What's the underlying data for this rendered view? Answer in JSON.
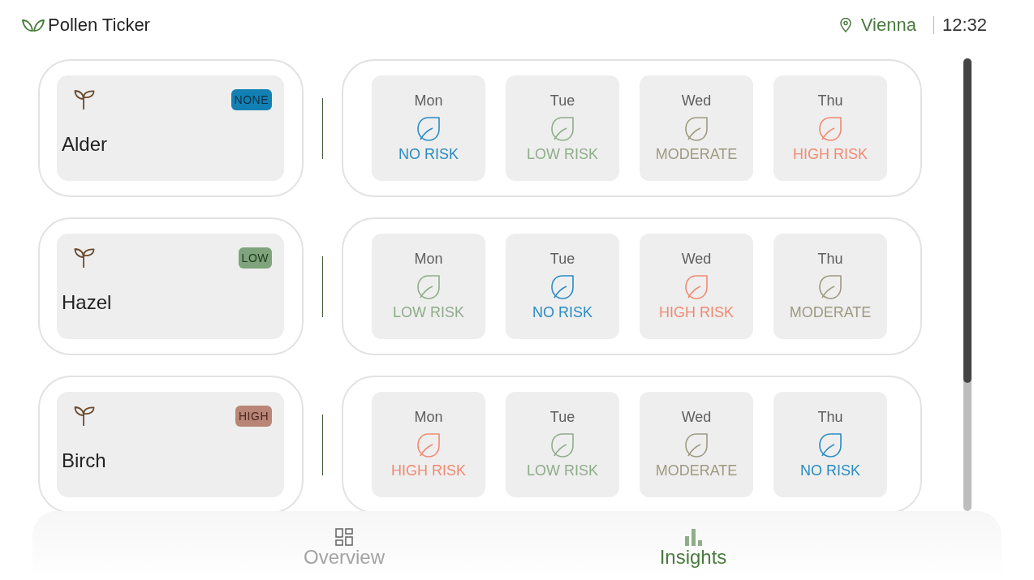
{
  "header": {
    "title": "Pollen Ticker",
    "location": "Vienna",
    "time": "12:32"
  },
  "pollen_types": [
    {
      "name": "Alder",
      "badge": "NONE",
      "kind": "none",
      "forecast": [
        {
          "day": "Mon",
          "risk": "NO RISK",
          "kind": "none"
        },
        {
          "day": "Tue",
          "risk": "LOW RISK",
          "kind": "low"
        },
        {
          "day": "Wed",
          "risk": "MODERATE",
          "kind": "moderate"
        },
        {
          "day": "Thu",
          "risk": "HIGH RISK",
          "kind": "high"
        }
      ]
    },
    {
      "name": "Hazel",
      "badge": "LOW",
      "kind": "low",
      "forecast": [
        {
          "day": "Mon",
          "risk": "LOW RISK",
          "kind": "low"
        },
        {
          "day": "Tue",
          "risk": "NO RISK",
          "kind": "none"
        },
        {
          "day": "Wed",
          "risk": "HIGH RISK",
          "kind": "high"
        },
        {
          "day": "Thu",
          "risk": "MODERATE",
          "kind": "moderate"
        }
      ]
    },
    {
      "name": "Birch",
      "badge": "HIGH",
      "kind": "high",
      "forecast": [
        {
          "day": "Mon",
          "risk": "HIGH RISK",
          "kind": "high"
        },
        {
          "day": "Tue",
          "risk": "LOW RISK",
          "kind": "low"
        },
        {
          "day": "Wed",
          "risk": "MODERATE",
          "kind": "moderate"
        },
        {
          "day": "Thu",
          "risk": "NO RISK",
          "kind": "none"
        }
      ]
    }
  ],
  "tabs": [
    {
      "label": "Overview",
      "kind": "overview",
      "selected": false
    },
    {
      "label": "Insights",
      "kind": "insights",
      "selected": true
    }
  ]
}
